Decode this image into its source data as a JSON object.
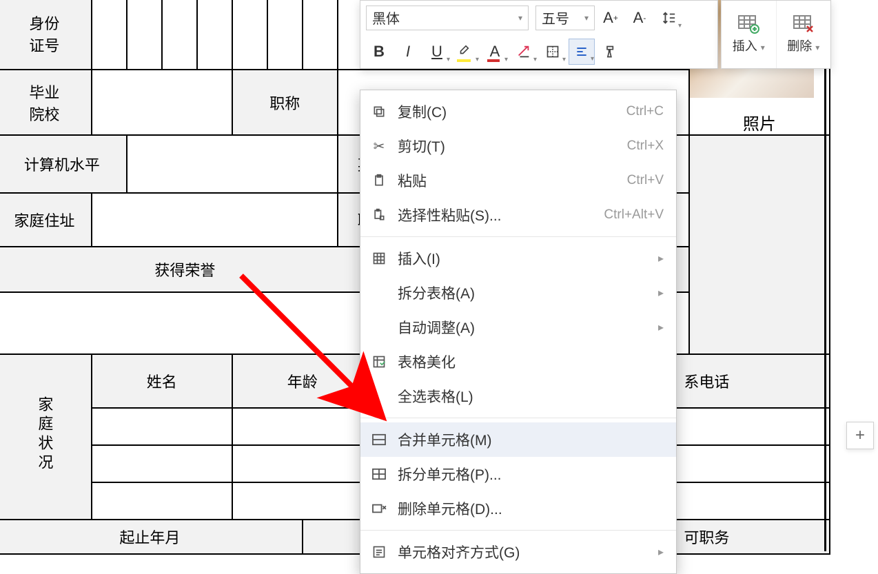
{
  "toolbar": {
    "font": "黑体",
    "size": "五号",
    "insert_label": "插入",
    "delete_label": "删除"
  },
  "table": {
    "id_label_1": "身份",
    "id_label_2": "证号",
    "grad_label_1": "毕业",
    "grad_label_2": "院校",
    "title_label": "职称",
    "computer_label": "计算机水平",
    "english_label": "英语",
    "addr_label": "家庭住址",
    "contact_label": "联系",
    "honor_label": "获得荣誉",
    "photo_label": "照片",
    "family_label": "家庭状况",
    "name_label": "姓名",
    "age_label": "年龄",
    "phone_label": "系电话",
    "period_partial": "起止年月",
    "job_partial": "可职务"
  },
  "ctx": {
    "copy": "复制(C)",
    "copy_sc": "Ctrl+C",
    "cut": "剪切(T)",
    "cut_sc": "Ctrl+X",
    "paste": "粘贴",
    "paste_sc": "Ctrl+V",
    "paste_special": "选择性粘贴(S)...",
    "paste_special_sc": "Ctrl+Alt+V",
    "insert": "插入(I)",
    "split_table": "拆分表格(A)",
    "autofit": "自动调整(A)",
    "beautify": "表格美化",
    "select_all": "全选表格(L)",
    "merge": "合并单元格(M)",
    "split_cell": "拆分单元格(P)...",
    "delete_cell": "删除单元格(D)...",
    "align": "单元格对齐方式(G)"
  }
}
